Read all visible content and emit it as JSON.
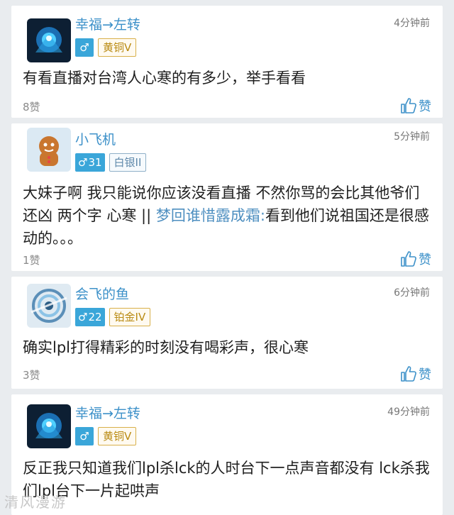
{
  "comments": [
    {
      "username": "幸福→左转",
      "time": "4分钟前",
      "gender_symbol": "♂",
      "level": "",
      "rank": "黄铜V",
      "content": "有看直播对台湾人心寒的有多少，举手看看",
      "quote": "",
      "likes": "8赞",
      "like_label": "赞"
    },
    {
      "username": "小飞机",
      "time": "5分钟前",
      "gender_symbol": "♂",
      "level": "31",
      "rank": "白银II",
      "content": "大妹子啊 我只能说你应该没看直播  不然你骂的会比其他爷们还凶  两个字  心寒 || ",
      "quote": "梦回谁惜露成霜:",
      "content_after": "看到他们说祖国还是很感动的。。。",
      "likes": "1赞",
      "like_label": "赞"
    },
    {
      "username": "会飞的鱼",
      "time": "6分钟前",
      "gender_symbol": "♂",
      "level": "22",
      "rank": "铂金IV",
      "content": "确实lpl打得精彩的时刻没有喝彩声，很心寒",
      "quote": "",
      "likes": "3赞",
      "like_label": "赞"
    },
    {
      "username": "幸福→左转",
      "time": "49分钟前",
      "gender_symbol": "♂",
      "level": "",
      "rank": "黄铜V",
      "content": "反正我只知道我们lpl杀lck的人时台下一点声音都没有  lck杀我们lpl台下一片起哄声",
      "quote": "",
      "likes": "",
      "like_label": ""
    }
  ],
  "watermark": "清风漫游",
  "colors": {
    "accent": "#3d91c9",
    "gender_badge": "#3aa6d9",
    "gold": "#b98a12",
    "silver": "#5e88aa"
  }
}
